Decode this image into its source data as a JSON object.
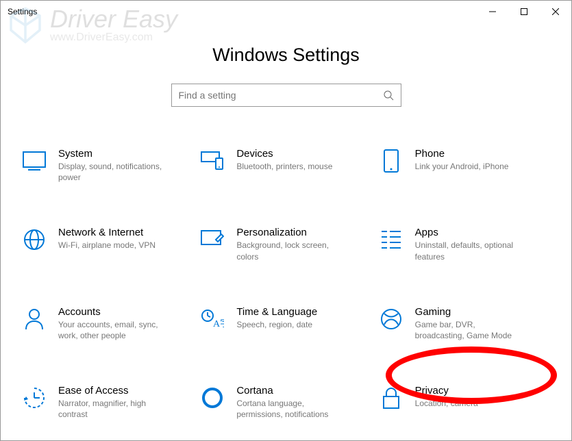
{
  "window": {
    "title": "Settings"
  },
  "watermark": {
    "brand": "Driver Easy",
    "url": "www.DriverEasy.com"
  },
  "page": {
    "title": "Windows Settings"
  },
  "search": {
    "placeholder": "Find a setting"
  },
  "tiles": [
    {
      "title": "System",
      "desc": "Display, sound, notifications, power"
    },
    {
      "title": "Devices",
      "desc": "Bluetooth, printers, mouse"
    },
    {
      "title": "Phone",
      "desc": "Link your Android, iPhone"
    },
    {
      "title": "Network & Internet",
      "desc": "Wi-Fi, airplane mode, VPN"
    },
    {
      "title": "Personalization",
      "desc": "Background, lock screen, colors"
    },
    {
      "title": "Apps",
      "desc": "Uninstall, defaults, optional features"
    },
    {
      "title": "Accounts",
      "desc": "Your accounts, email, sync, work, other people"
    },
    {
      "title": "Time & Language",
      "desc": "Speech, region, date"
    },
    {
      "title": "Gaming",
      "desc": "Game bar, DVR, broadcasting, Game Mode"
    },
    {
      "title": "Ease of Access",
      "desc": "Narrator, magnifier, high contrast"
    },
    {
      "title": "Cortana",
      "desc": "Cortana language, permissions, notifications"
    },
    {
      "title": "Privacy",
      "desc": "Location, camera"
    }
  ]
}
